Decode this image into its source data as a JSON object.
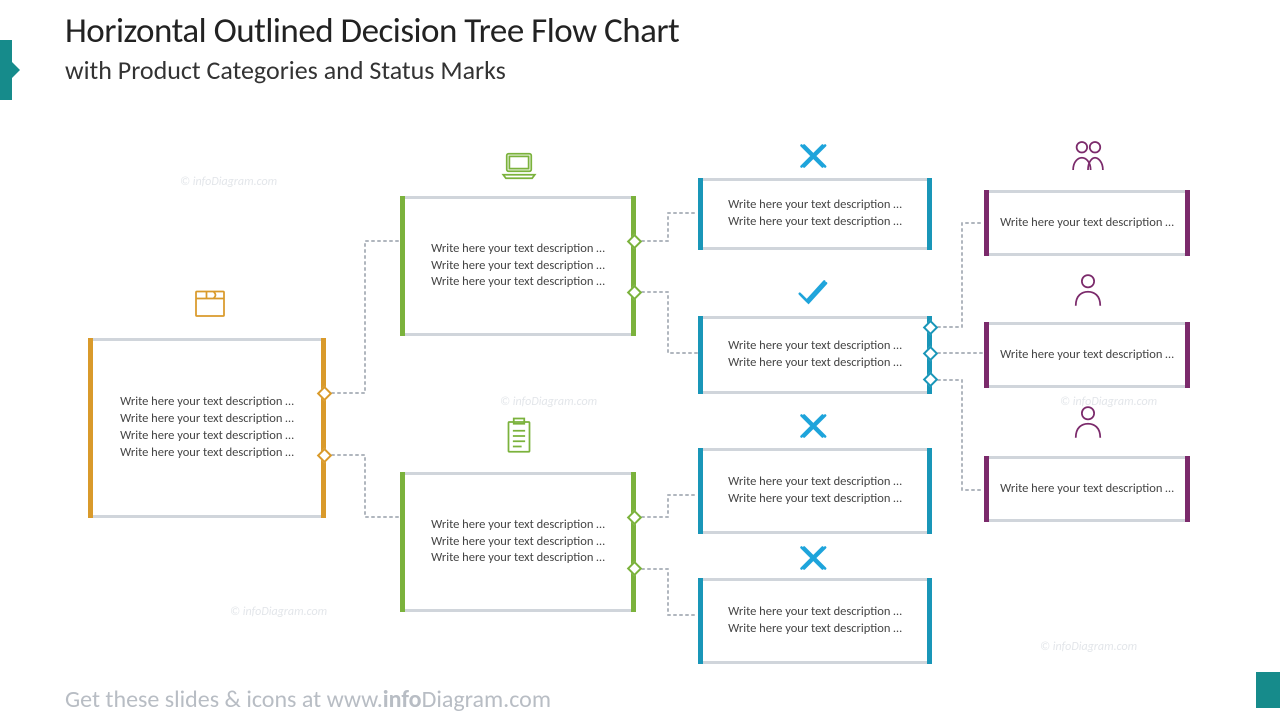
{
  "header": {
    "title": "Horizontal Outlined Decision Tree Flow Chart",
    "subtitle": "with Product Categories and Status Marks"
  },
  "placeholder": "Write here your text description …",
  "nodes": {
    "root": {
      "lines": 4,
      "color": "orange",
      "icon": "box"
    },
    "a": {
      "lines": 3,
      "color": "green",
      "icon": "laptop"
    },
    "b": {
      "lines": 3,
      "color": "green",
      "icon": "clipboard"
    },
    "a1": {
      "lines": 2,
      "color": "teal",
      "icon": "cross"
    },
    "a2": {
      "lines": 2,
      "color": "teal",
      "icon": "check"
    },
    "b1": {
      "lines": 2,
      "color": "teal",
      "icon": "cross"
    },
    "b2": {
      "lines": 2,
      "color": "teal",
      "icon": "cross"
    },
    "p1": {
      "lines": 1,
      "color": "purple",
      "icon": "people-two"
    },
    "p2": {
      "lines": 1,
      "color": "purple",
      "icon": "person"
    },
    "p3": {
      "lines": 1,
      "color": "purple",
      "icon": "person"
    }
  },
  "footer": {
    "pre": "Get these slides & icons at www.",
    "bold": "info",
    "rest": "Diagram.com"
  },
  "watermark": "© infoDiagram.com"
}
